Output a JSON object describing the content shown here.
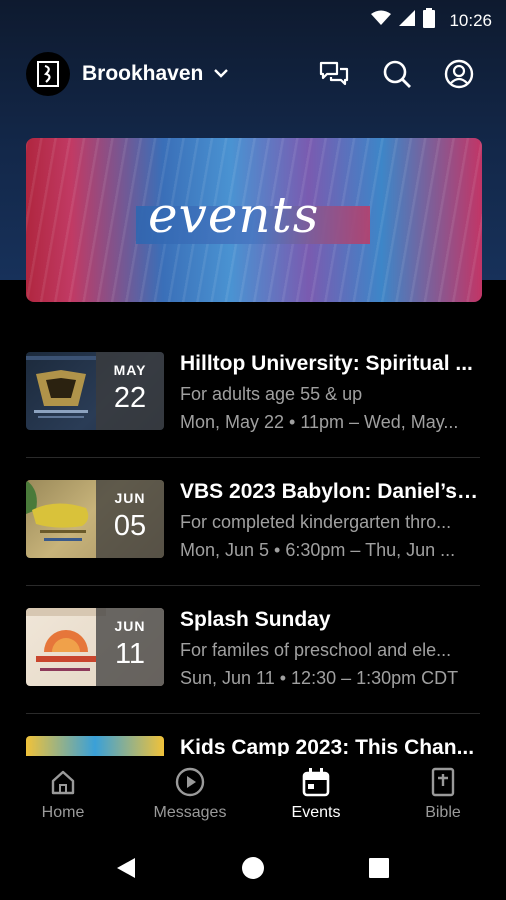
{
  "status_bar": {
    "time": "10:26"
  },
  "header": {
    "org_name": "Brookhaven"
  },
  "banner": {
    "text": "events"
  },
  "events": [
    {
      "title": "Hilltop University: Spiritual ...",
      "subtitle": "For adults age 55 & up",
      "date": "Mon, May 22 • 11pm – Wed, May...",
      "month": "MAY",
      "day": "22"
    },
    {
      "title": "VBS 2023 Babylon: Daniel’s ...",
      "subtitle": "For completed kindergarten thro...",
      "date": "Mon, Jun 5 • 6:30pm – Thu, Jun ...",
      "month": "JUN",
      "day": "05"
    },
    {
      "title": "Splash Sunday",
      "subtitle": "For familes of preschool and ele...",
      "date": "Sun, Jun 11 • 12:30 – 1:30pm CDT",
      "month": "JUN",
      "day": "11"
    },
    {
      "title": "Kids Camp 2023: This Chan...",
      "subtitle": "",
      "date": "",
      "month": "",
      "day": ""
    }
  ],
  "bottom_nav": [
    {
      "label": "Home",
      "icon": "home-icon"
    },
    {
      "label": "Messages",
      "icon": "play-circle-icon"
    },
    {
      "label": "Events",
      "icon": "calendar-icon",
      "active": true
    },
    {
      "label": "Bible",
      "icon": "bible-icon"
    }
  ],
  "colors": {
    "header_gradient_top": "#0e1a2f",
    "header_gradient_bottom": "#17315a",
    "background": "#000000",
    "muted_text": "#a0a0a0"
  }
}
